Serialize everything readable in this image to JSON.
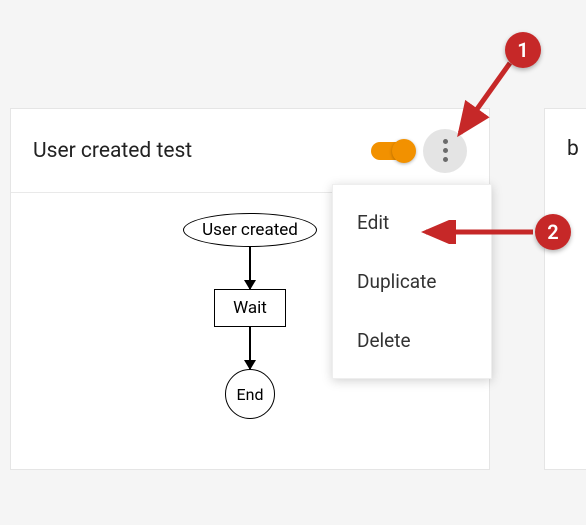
{
  "card": {
    "title": "User created test",
    "toggle_on": true,
    "flow": {
      "trigger": "User created",
      "step": "Wait",
      "end": "End"
    },
    "menu": {
      "edit": "Edit",
      "duplicate": "Duplicate",
      "delete": "Delete"
    }
  },
  "card2": {
    "title_fragment": "b"
  },
  "annotations": {
    "step1": "1",
    "step2": "2"
  },
  "colors": {
    "accent": "#f29100",
    "callout": "#c62828"
  }
}
